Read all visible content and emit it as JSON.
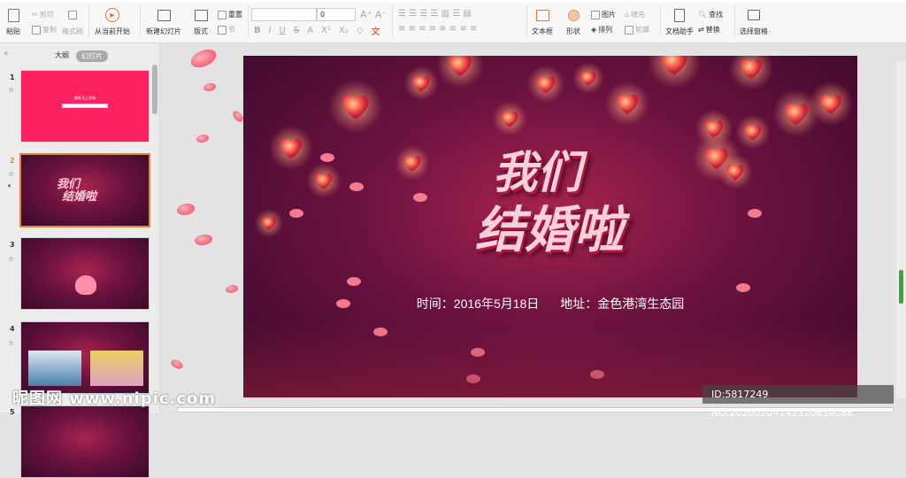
{
  "toolbar": {
    "paste": "粘贴",
    "cut": "剪切",
    "copy": "复制",
    "format_painter": "格式刷",
    "from_current": "从当前开始",
    "new_slide": "新建幻灯片",
    "layout": "版式",
    "reset": "重置",
    "section": "节",
    "font_name": "",
    "font_size": "0",
    "text_box": "文本框",
    "shape": "形状",
    "picture": "图片",
    "fill": "填充",
    "arrange": "排列",
    "outline": "轮廓",
    "doc_assistant": "文档助手",
    "find": "查找",
    "replace": "替换",
    "selection_pane": "选择窗格"
  },
  "sidebar": {
    "tabs": [
      {
        "label": "大纲",
        "active": false
      },
      {
        "label": "幻灯片",
        "active": true
      }
    ],
    "collapse": "«",
    "slides": [
      {
        "number": "1",
        "text": "婚礼马上开始"
      },
      {
        "number": "2",
        "selected": true
      },
      {
        "number": "3"
      },
      {
        "number": "4"
      },
      {
        "number": "5"
      }
    ]
  },
  "slide": {
    "title_line1": "我们",
    "title_line2": "结婚啦",
    "time": "时间：2016年5月18日",
    "address": "地址：金色港湾生态园"
  },
  "watermark": {
    "logo": "昵图网 www.nipic.com",
    "id": "ID:5817249 NO:20200204142320659086"
  },
  "colors": {
    "accent": "#e0883a",
    "slide_bg": "#6b1240",
    "title_pink": "#fbd0dc"
  }
}
